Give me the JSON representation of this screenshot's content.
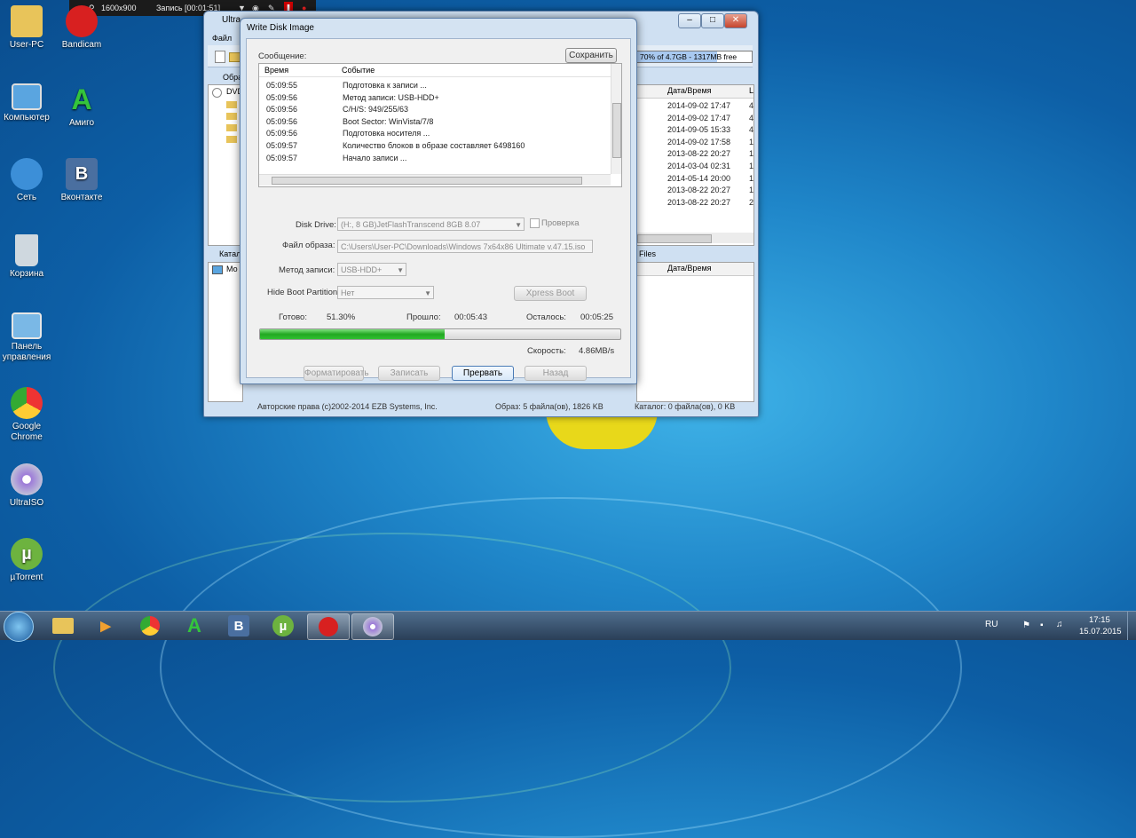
{
  "recorder": {
    "resolution": "1600x900",
    "status": "Запись [00:01:51]"
  },
  "desktop_icons": [
    {
      "label": "User-PC"
    },
    {
      "label": "Bandicam"
    },
    {
      "label": "Компьютер"
    },
    {
      "label": "Амиго"
    },
    {
      "label": "Сеть"
    },
    {
      "label": "Вконтакте"
    },
    {
      "label": "Корзина"
    },
    {
      "label": "Панель управления"
    },
    {
      "label": "Google Chrome"
    },
    {
      "label": "UltraISO"
    },
    {
      "label": "µTorrent"
    }
  ],
  "ultraiso": {
    "title": "Ultra",
    "menu_file": "Файл",
    "toolbar_label": "Обра",
    "capacity": "70% of 4.7GB - 1317MB free",
    "tree_root": "DVD",
    "catalog_tab": "Катал",
    "tree2_root": "Мо",
    "files_tab": "Files",
    "col_datetime": "Дата/Время",
    "col_l": "L",
    "dates": [
      "2014-09-02 17:47",
      "2014-09-02 17:47",
      "2014-09-05 15:33",
      "2014-09-02 17:58",
      "2013-08-22 20:27",
      "2014-03-04 02:31",
      "2014-05-14 20:00",
      "2013-08-22 20:27",
      "2013-08-22 20:27"
    ],
    "size_col": [
      "4",
      "4",
      "4",
      "1",
      "1",
      "1",
      "1",
      "1",
      "2"
    ],
    "status_copyright": "Авторские права (c)2002-2014 EZB Systems, Inc.",
    "status_image": "Образ: 5 файла(ов), 1826 KB",
    "status_catalog": "Каталог: 0 файла(ов), 0 KB"
  },
  "dialog": {
    "title": "Write Disk Image",
    "message_label": "Сообщение:",
    "save_button": "Сохранить",
    "col_time": "Время",
    "col_event": "Событие",
    "log": [
      {
        "time": "05:09:55",
        "event": "Подготовка к записи ..."
      },
      {
        "time": "05:09:56",
        "event": "Метод записи: USB-HDD+"
      },
      {
        "time": "05:09:56",
        "event": "C/H/S: 949/255/63"
      },
      {
        "time": "05:09:56",
        "event": "Boot Sector: WinVista/7/8"
      },
      {
        "time": "05:09:56",
        "event": "Подготовка носителя ..."
      },
      {
        "time": "05:09:57",
        "event": "Количество блоков в образе составляет 6498160"
      },
      {
        "time": "05:09:57",
        "event": "Начало записи ..."
      }
    ],
    "disk_drive_label": "Disk Drive:",
    "disk_drive_value": "(H:, 8 GB)JetFlashTranscend 8GB   8.07",
    "verify_label": "Проверка",
    "image_file_label": "Файл образа:",
    "image_file_value": "C:\\Users\\User-PC\\Downloads\\Windows 7x64x86 Ultimate v.47.15.iso",
    "write_method_label": "Метод записи:",
    "write_method_value": "USB-HDD+",
    "hide_boot_label": "Hide Boot Partition:",
    "hide_boot_value": "Нет",
    "xpress_boot": "Xpress Boot",
    "done_label": "Готово:",
    "done_value": "51.30%",
    "progress": 0.513,
    "elapsed_label": "Прошло:",
    "elapsed_value": "00:05:43",
    "remaining_label": "Осталось:",
    "remaining_value": "00:05:25",
    "speed_label": "Скорость:",
    "speed_value": "4.86MB/s",
    "format_button": "Форматировать",
    "write_button": "Записать",
    "abort_button": "Прервать",
    "back_button": "Назад"
  },
  "taskbar": {
    "lang": "RU",
    "time": "17:15",
    "date": "15.07.2015"
  },
  "colors": {
    "progress": "#2fb52f",
    "desktop": "#1f86c9"
  }
}
